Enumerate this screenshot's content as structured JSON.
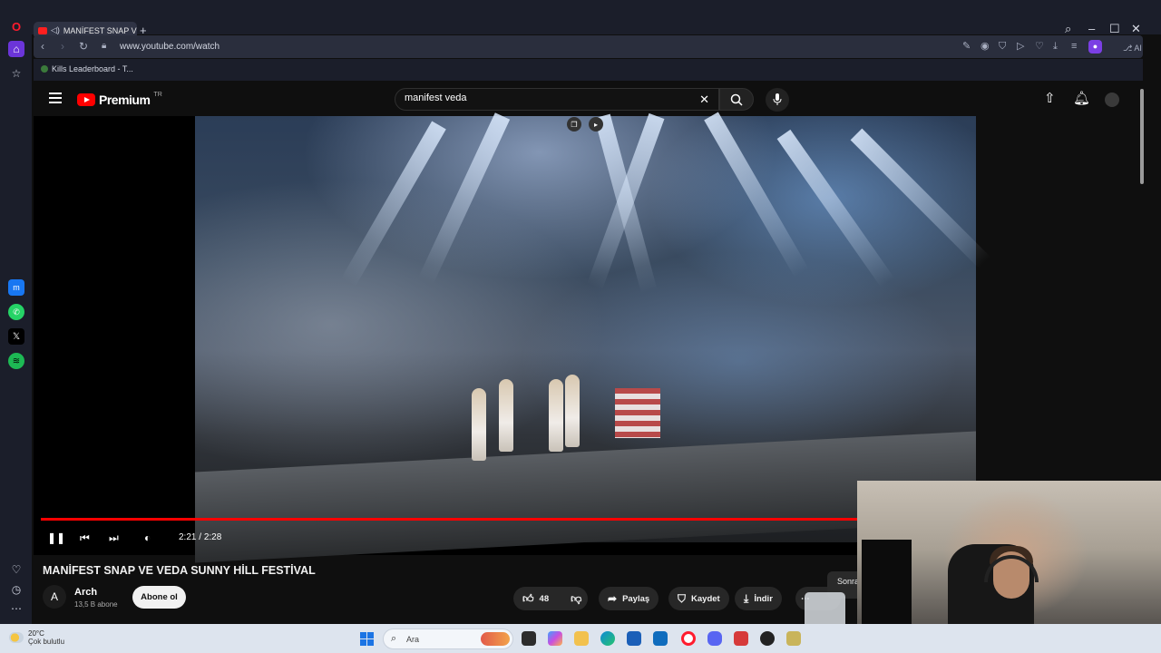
{
  "browser": {
    "tab_title": "MANİFEST SNAP VE VEDA SUNNY HİLL FESTİVAL",
    "url": "www.youtube.com/watch",
    "bookmark": "Kills Leaderboard - T...",
    "ai_label": "AI"
  },
  "youtube": {
    "logo_text": "Premium",
    "logo_region": "TR",
    "search_value": "manifest veda",
    "video": {
      "time_current": "2:21",
      "time_separator": "/",
      "time_total": "2:28",
      "progress": 0.78,
      "title": "MANİFEST SNAP VE VEDA SUNNY HİLL FESTİVAL"
    },
    "channel": {
      "initial": "A",
      "name": "Arch",
      "subs": "13,5 B abone",
      "subscribe_label": "Abone ol"
    },
    "actions": {
      "likes": "48",
      "share": "Paylaş",
      "save": "Kaydet",
      "download": "İndir"
    },
    "next_label": "Sonra"
  },
  "taskbar": {
    "temperature": "20°C",
    "weather": "Çok bulutlu",
    "search_placeholder": "Ara"
  },
  "colors": {
    "accent_red": "#ff0000",
    "chrome_bg": "#1b1e2a",
    "yt_bg": "#0f0f0f"
  }
}
